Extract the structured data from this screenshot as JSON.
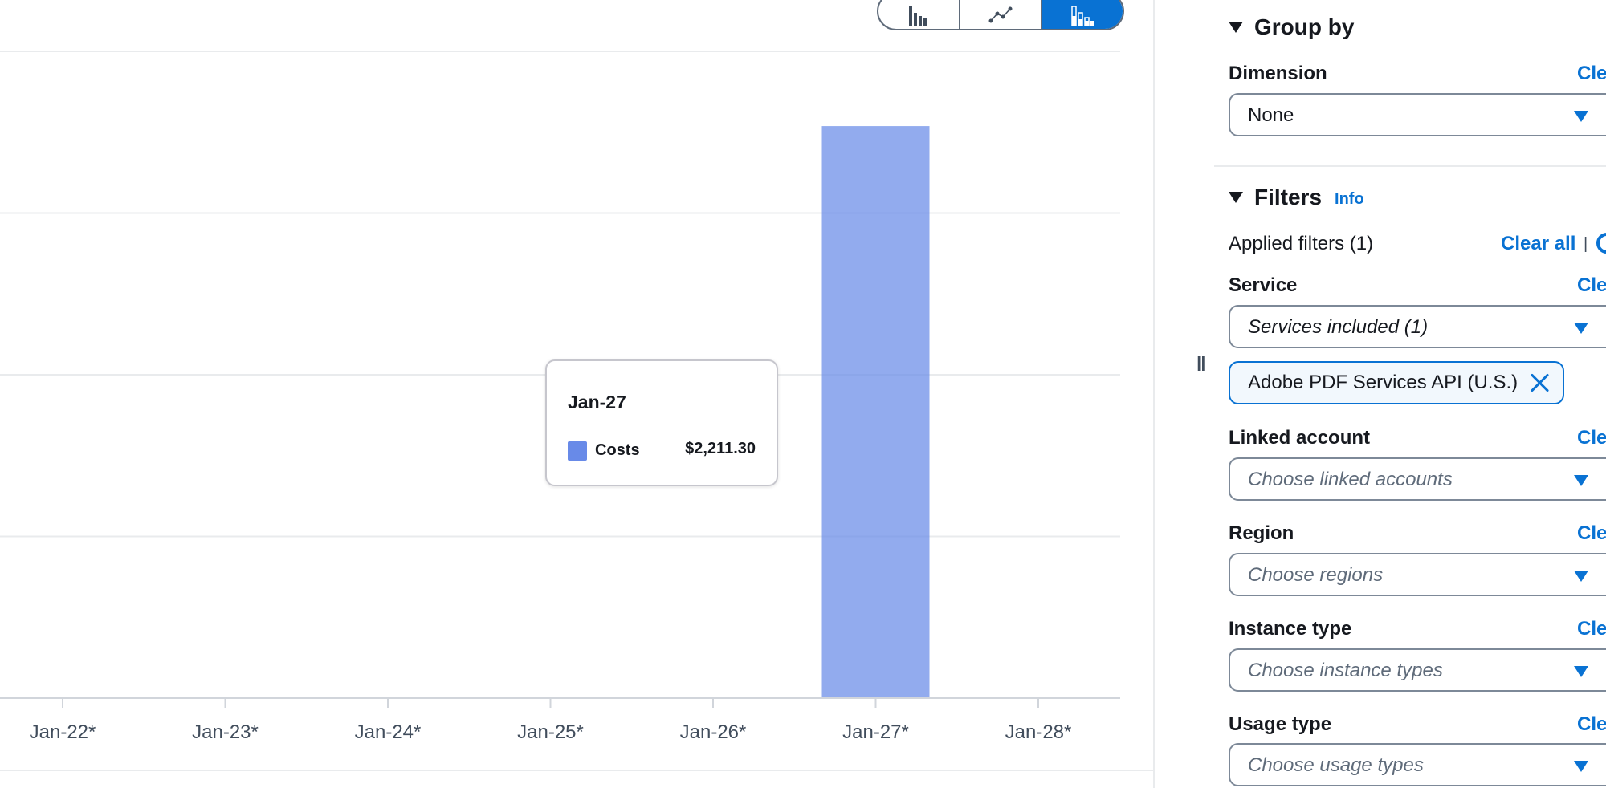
{
  "chart_toolbar": {
    "buttons": [
      {
        "icon": "bar-chart-icon",
        "selected": false
      },
      {
        "icon": "line-chart-icon",
        "selected": false
      },
      {
        "icon": "stacked-bar-chart-icon",
        "selected": true
      }
    ]
  },
  "chart_data": {
    "type": "bar",
    "categories": [
      "Jan-22*",
      "Jan-23*",
      "Jan-24*",
      "Jan-25*",
      "Jan-26*",
      "Jan-27*",
      "Jan-28*"
    ],
    "series": [
      {
        "name": "Costs",
        "values": [
          0,
          0,
          0,
          0,
          0,
          2211.3,
          0
        ],
        "color": "#688ae8"
      }
    ],
    "ylim": [
      0,
      2500
    ],
    "grid": true
  },
  "tooltip": {
    "title": "Jan-27",
    "label": "Costs",
    "value": "$2,211.30",
    "swatch_color": "#688ae8"
  },
  "drag_handle": "II",
  "side_panel": {
    "group_by": {
      "heading": "Group by",
      "dimension_label": "Dimension",
      "clear_label": "Cle",
      "dimension_value": "None"
    },
    "filters": {
      "heading": "Filters",
      "info_label": "Info",
      "applied_text": "Applied filters (1)",
      "clear_all_label": "Clear all",
      "separator": "|",
      "service": {
        "label": "Service",
        "clear_label": "Cle",
        "value": "Services included (1)",
        "token": "Adobe PDF Services API (U.S.)"
      },
      "linked_account": {
        "label": "Linked account",
        "clear_label": "Cle",
        "placeholder": "Choose linked accounts"
      },
      "region": {
        "label": "Region",
        "clear_label": "Cle",
        "placeholder": "Choose regions"
      },
      "instance_type": {
        "label": "Instance type",
        "clear_label": "Cle",
        "placeholder": "Choose instance types"
      },
      "usage_type": {
        "label": "Usage type",
        "clear_label": "Cle",
        "placeholder": "Choose usage types"
      }
    }
  },
  "colors": {
    "accent": "#0972d3",
    "bar": "#688ae8",
    "gridline": "#e9ebed",
    "text": "#16191f"
  }
}
